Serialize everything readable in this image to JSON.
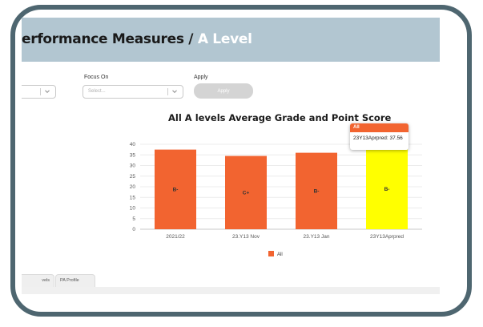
{
  "header": {
    "title": "erformance Measures",
    "separator": " / ",
    "section": "A Level"
  },
  "filters": {
    "first_dropdown": {
      "placeholder": ""
    },
    "focus_on": {
      "label": "Focus On",
      "placeholder": "Select..."
    },
    "apply": {
      "label": "Apply",
      "button_label": "Apply"
    }
  },
  "tabs": [
    {
      "label": "vels"
    },
    {
      "label": "PA Profile"
    }
  ],
  "tooltip": {
    "series": "All",
    "text": "23Y13Aprpred: 37.56"
  },
  "colors": {
    "header_bg": "#b2c6d1",
    "bar": "#f26430",
    "highlight_bar": "#ffff00",
    "frame": "#4e6670"
  },
  "chart_data": {
    "type": "bar",
    "title": "All A levels Average Grade and Point Score",
    "categories": [
      "2021/22",
      "23.Y13 Nov",
      "23.Y13 Jan",
      "23Y13Aprpred"
    ],
    "series": [
      {
        "name": "All",
        "values": [
          37.5,
          34.5,
          36.0,
          37.56
        ],
        "labels": [
          "B-",
          "C+",
          "B-",
          "B-"
        ]
      }
    ],
    "highlighted_index": 3,
    "ylim": [
      0,
      40
    ],
    "yticks": [
      0,
      5,
      10,
      15,
      20,
      25,
      30,
      35,
      40
    ],
    "grid": true,
    "legend": "bottom"
  }
}
